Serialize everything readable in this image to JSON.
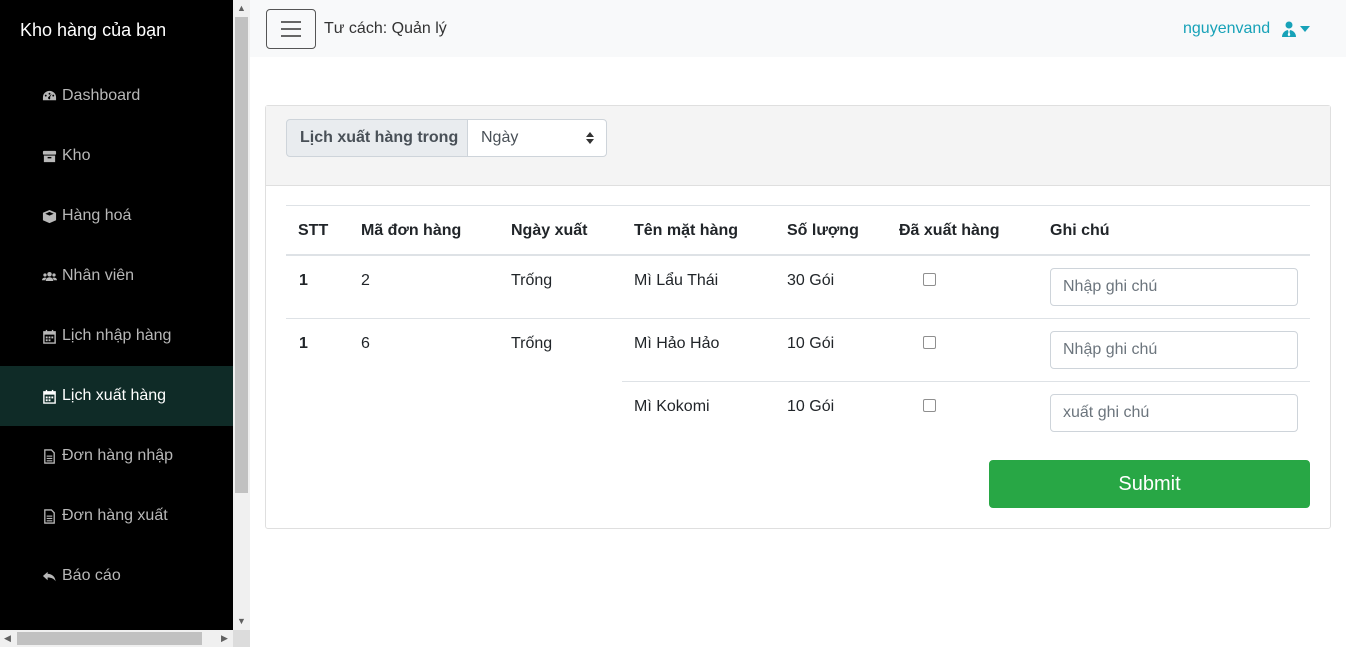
{
  "sidebar": {
    "brand": "Kho hàng của bạn",
    "items": [
      {
        "label": "Dashboard",
        "icon": "dashboard-icon"
      },
      {
        "label": "Kho",
        "icon": "archive-icon"
      },
      {
        "label": "Hàng hoá",
        "icon": "cube-icon"
      },
      {
        "label": "Nhân viên",
        "icon": "users-icon"
      },
      {
        "label": "Lịch nhập hàng",
        "icon": "calendar-icon"
      },
      {
        "label": "Lịch xuất hàng",
        "icon": "calendar-icon",
        "active": true
      },
      {
        "label": "Đơn hàng nhập",
        "icon": "file-icon"
      },
      {
        "label": "Đơn hàng xuất",
        "icon": "file-icon"
      },
      {
        "label": "Báo cáo",
        "icon": "reply-icon"
      }
    ]
  },
  "topbar": {
    "role": "Tư cách: Quản lý",
    "username": "nguyenvand",
    "user_icon": "user-tie-icon"
  },
  "filter": {
    "label": "Lịch xuất hàng trong",
    "selected": "Ngày"
  },
  "table": {
    "headers": [
      "STT",
      "Mã đơn hàng",
      "Ngày xuất",
      "Tên mặt hàng",
      "Số lượng",
      "Đã xuất hàng",
      "Ghi chú"
    ],
    "orders": [
      {
        "stt": "1",
        "code": "2",
        "date": "Trống",
        "items": [
          {
            "name": "Mì Lẩu Thái",
            "qty": "30 Gói",
            "shipped": false,
            "note_placeholder": "Nhập ghi chú"
          }
        ]
      },
      {
        "stt": "1",
        "code": "6",
        "date": "Trống",
        "items": [
          {
            "name": "Mì Hảo Hảo",
            "qty": "10 Gói",
            "shipped": false,
            "note_placeholder": "Nhập ghi chú"
          },
          {
            "name": "Mì Kokomi",
            "qty": "10 Gói",
            "shipped": false,
            "note_placeholder": "xuất ghi chú"
          }
        ]
      }
    ]
  },
  "submit_label": "Submit",
  "colors": {
    "sidebar_bg": "#000000",
    "active_item_bg": "#0f2b27",
    "accent": "#17a2b8",
    "submit": "#28a745"
  }
}
